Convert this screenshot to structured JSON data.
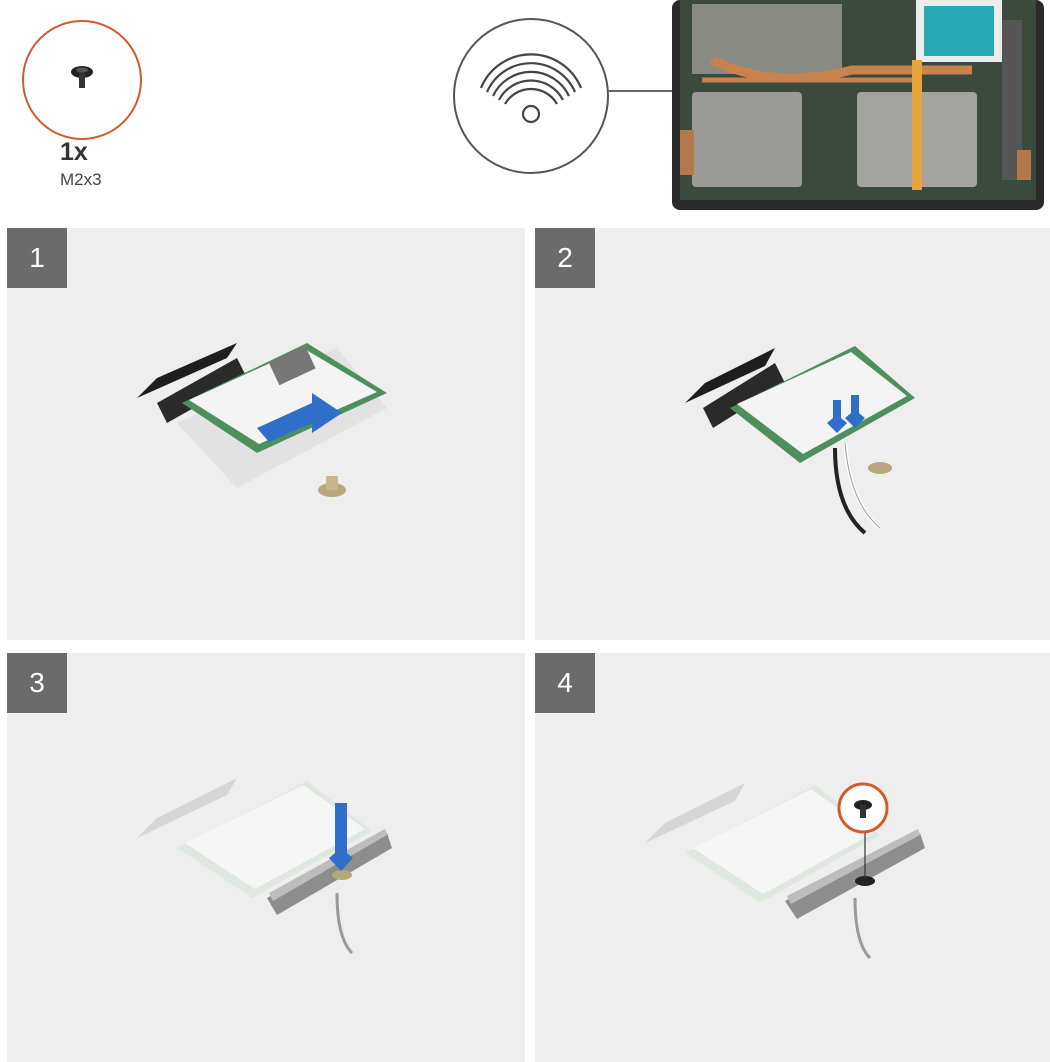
{
  "screw": {
    "quantity": "1x",
    "size": "M2x3",
    "accent_color": "#d35b2b"
  },
  "icons": {
    "wifi": "wifi-icon",
    "screw": "screw-icon"
  },
  "steps": [
    {
      "number": "1",
      "action": "slide-card-into-slot"
    },
    {
      "number": "2",
      "action": "connect-antenna-cables"
    },
    {
      "number": "3",
      "action": "place-bracket"
    },
    {
      "number": "4",
      "action": "install-screw"
    }
  ],
  "colors": {
    "panel_bg": "#eeeeee",
    "step_badge": "#6b6b6b",
    "arrow_blue": "#2f6fc9",
    "pcb_green": "#4e8f5e"
  }
}
